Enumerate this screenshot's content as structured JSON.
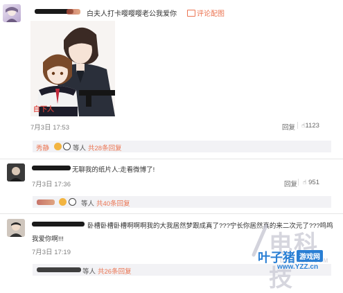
{
  "comments": [
    {
      "text": "白夫人打卡嘤嘤嘤老公我爱你",
      "tag_label": "评论配图",
      "time": "7月3日 17:53",
      "reply_label": "回复",
      "like_count": "1123",
      "replies": {
        "who": "秀静",
        "mid": "等人",
        "count_label": "共28条回复"
      },
      "image_caption": "白下人"
    },
    {
      "text": "无聊我的纸片人:走看微博了!",
      "time": "7月3日 17:36",
      "reply_label": "回复",
      "like_count": "951",
      "replies": {
        "mid": "等人",
        "count_label": "共40条回复"
      }
    },
    {
      "text": "卧槽卧槽卧槽啊啊啊我的大我居然梦跟成真了???宁长你居然真的来二次元了???鸣鸣我爱你啊!!!",
      "time": "7月3日 17:19",
      "replies": {
        "mid": "等人",
        "count_label": "共26条回复"
      }
    }
  ],
  "watermark": {
    "site_cn": "叶子猪",
    "game_net": "游戏网",
    "url": "www.YZZ.cn",
    "bg_text": "电科技",
    "bg_url": "DIANKEJI.COM"
  },
  "colors": {
    "accent": "#eb7350",
    "strip": "#f2f2f5",
    "watermark_blue": "#2a7fd4"
  }
}
